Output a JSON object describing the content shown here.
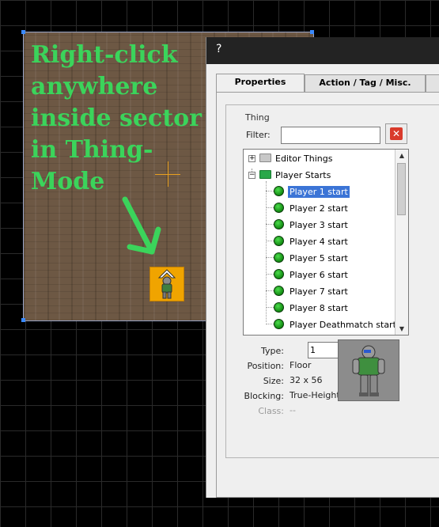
{
  "viewport": {
    "help_text": "Right-click anywhere inside sector in Thing-Mode",
    "colors": {
      "help_text": "#3bd45b",
      "sector_edge": "#9aa5c8",
      "vertex": "#3a8aff",
      "thing_marker": "#f0a400",
      "crosshair": "#e8a020"
    },
    "icons": {
      "arrow": "down-left-arrow-icon",
      "thing": "player-start-thing-icon"
    }
  },
  "dialog": {
    "help_button": "?",
    "tabs": [
      {
        "label": "Properties",
        "active": true
      },
      {
        "label": "Action / Tag / Misc.",
        "active": false
      }
    ],
    "thing_group": {
      "title": "Thing",
      "filter_label": "Filter:",
      "filter_value": "",
      "clear_icon": "clear-filter-icon",
      "tree": {
        "categories": [
          {
            "label": "Editor Things",
            "expanded": false,
            "icon": "folder-icon"
          },
          {
            "label": "Player Starts",
            "expanded": true,
            "icon": "folder-open-icon"
          }
        ],
        "items": [
          {
            "label": "Player 1 start",
            "selected": true
          },
          {
            "label": "Player 2 start",
            "selected": false
          },
          {
            "label": "Player 3 start",
            "selected": false
          },
          {
            "label": "Player 4 start",
            "selected": false
          },
          {
            "label": "Player 5 start",
            "selected": false
          },
          {
            "label": "Player 6 start",
            "selected": false
          },
          {
            "label": "Player 7 start",
            "selected": false
          },
          {
            "label": "Player 8 start",
            "selected": false
          },
          {
            "label": "Player Deathmatch start",
            "selected": false
          }
        ]
      },
      "properties": {
        "type_label": "Type:",
        "type_value": "1",
        "position_label": "Position:",
        "position_value": "Floor",
        "size_label": "Size:",
        "size_value": "32 x 56",
        "blocking_label": "Blocking:",
        "blocking_value": "True-Height",
        "class_label": "Class:",
        "class_value": "--"
      },
      "preview_icon": "player-sprite-preview"
    }
  }
}
